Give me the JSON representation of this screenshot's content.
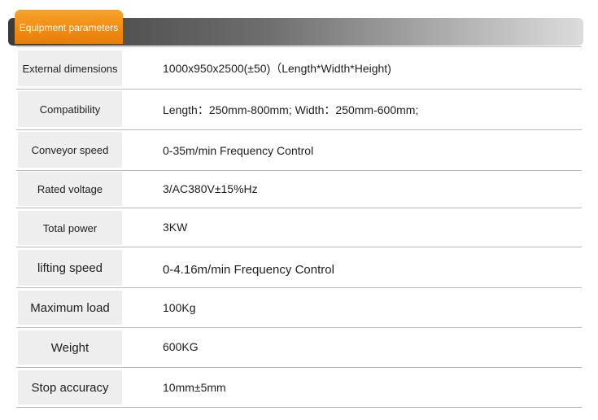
{
  "header": {
    "tab_label": "Equipment parameters"
  },
  "rows": [
    {
      "label": "External dimensions",
      "value": "1000x950x2500(±50)（Length*Width*Height)"
    },
    {
      "label": "Compatibility",
      "value": "Length：250mm-800mm;   Width：250mm-600mm;"
    },
    {
      "label": "Conveyor speed",
      "value": "0-35m/min Frequency Control"
    },
    {
      "label": "Rated voltage",
      "value": "3/AC380V±15%Hz"
    },
    {
      "label": "Total power",
      "value": "3KW"
    },
    {
      "label": "lifting speed",
      "value": "0-4.16m/min Frequency Control"
    },
    {
      "label": "Maximum load",
      "value": "100Kg"
    },
    {
      "label": "Weight",
      "value": "600KG"
    },
    {
      "label": "Stop accuracy",
      "value": "10mm±5mm"
    }
  ]
}
